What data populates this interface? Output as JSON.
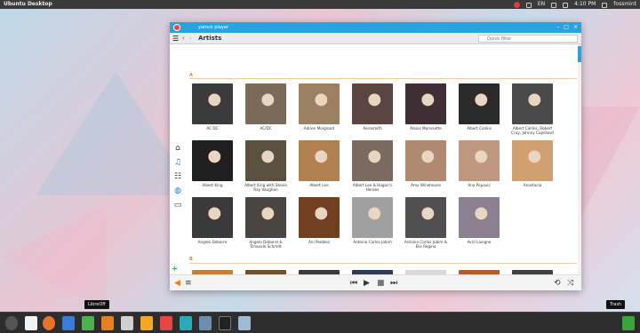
{
  "top_panel": {
    "title": "Ubuntu Desktop",
    "lang": "EN",
    "time": "4:10 PM",
    "user": "fossmint"
  },
  "window": {
    "title": "yarock player",
    "heading": "Artists",
    "filter_placeholder": "Quick filter"
  },
  "sections": [
    {
      "letter": "A"
    },
    {
      "letter": "B"
    }
  ],
  "artists": [
    {
      "name": "AC DC",
      "color": "#3b3b3b"
    },
    {
      "name": "AC/DC",
      "color": "#7a6a5a"
    },
    {
      "name": "Adrien Moignard",
      "color": "#9a8060"
    },
    {
      "name": "Aerosmith",
      "color": "#5a4540"
    },
    {
      "name": "Alanis Morissette",
      "color": "#403035"
    },
    {
      "name": "Albert Collins",
      "color": "#2a2a2a"
    },
    {
      "name": "Albert Collins, Robert Cray, Johnny Copeland",
      "color": "#4a4a4a"
    },
    {
      "name": "Albert King",
      "color": "#1f1f1f"
    },
    {
      "name": "Albert King with Stevie Ray Vaughan",
      "color": "#5a5040"
    },
    {
      "name": "Albert Lee",
      "color": "#b08050"
    },
    {
      "name": "Albert Lee & Hogan's Heroes",
      "color": "#7a6a60"
    },
    {
      "name": "Amy Winehouse",
      "color": "#b08a70"
    },
    {
      "name": "Ana Popovic",
      "color": "#c09880"
    },
    {
      "name": "Anastacia",
      "color": "#d0a070"
    },
    {
      "name": "Angelo Debarre",
      "color": "#3a3a3a"
    },
    {
      "name": "Angelo Debarre & Tchavolo Schmitt",
      "color": "#4a4540"
    },
    {
      "name": "Ani Peebles",
      "color": "#704020"
    },
    {
      "name": "Antonio Carlos Jobim",
      "color": "#a0a0a0"
    },
    {
      "name": "Antonio Carlos Jobim & Elis Regina",
      "color": "#505050"
    },
    {
      "name": "Avril Lavigne",
      "color": "#8a8090"
    }
  ],
  "b_row": [
    {
      "color": "#c08040"
    },
    {
      "color": "#705030"
    },
    {
      "color": "#3a3a3a"
    },
    {
      "color": "#303a50"
    },
    {
      "color": "#d8d8d8"
    },
    {
      "color": "#b06030"
    },
    {
      "color": "#404040"
    }
  ],
  "tooltips": {
    "libreoffice": "LibreOff",
    "trash": "Trash"
  },
  "colors": {
    "accent": "#29a3df",
    "section": "#f07d1a"
  }
}
